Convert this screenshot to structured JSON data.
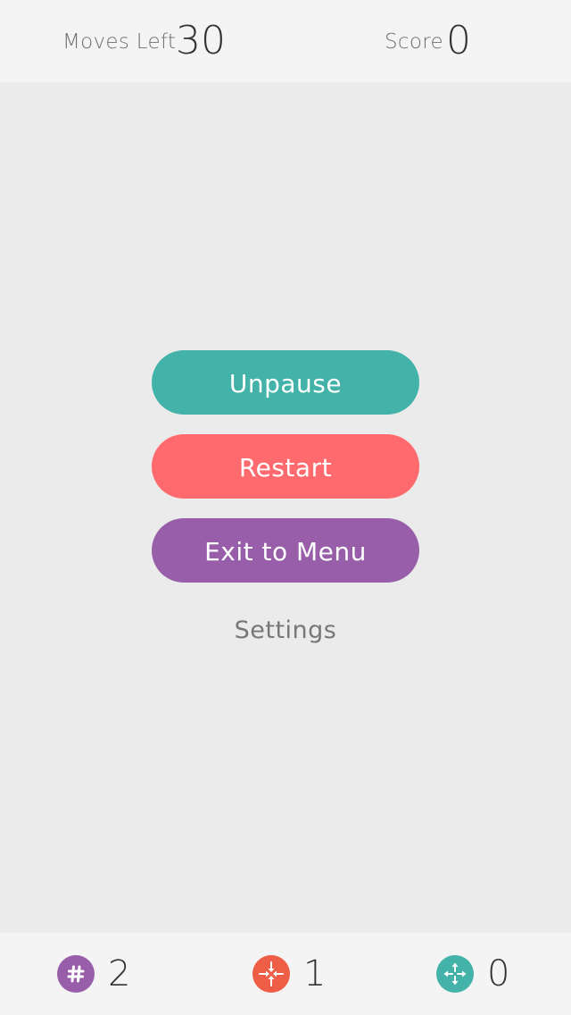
{
  "header": {
    "moves_label": "Moves Left",
    "moves_value": "30",
    "score_label": "Score",
    "score_value": "0"
  },
  "menu": {
    "unpause": "Unpause",
    "restart": "Restart",
    "exit": "Exit to Menu",
    "settings": "Settings"
  },
  "colors": {
    "teal": "#43b2a8",
    "coral": "#fe6a6d",
    "purple": "#985ea9",
    "orange": "#ee5d45"
  },
  "powerups": [
    {
      "icon": "hash-icon",
      "color": "#985ea9",
      "count": "2"
    },
    {
      "icon": "collapse-arrows-icon",
      "color": "#ee5d45",
      "count": "1"
    },
    {
      "icon": "expand-arrows-icon",
      "color": "#43b2a8",
      "count": "0"
    }
  ]
}
